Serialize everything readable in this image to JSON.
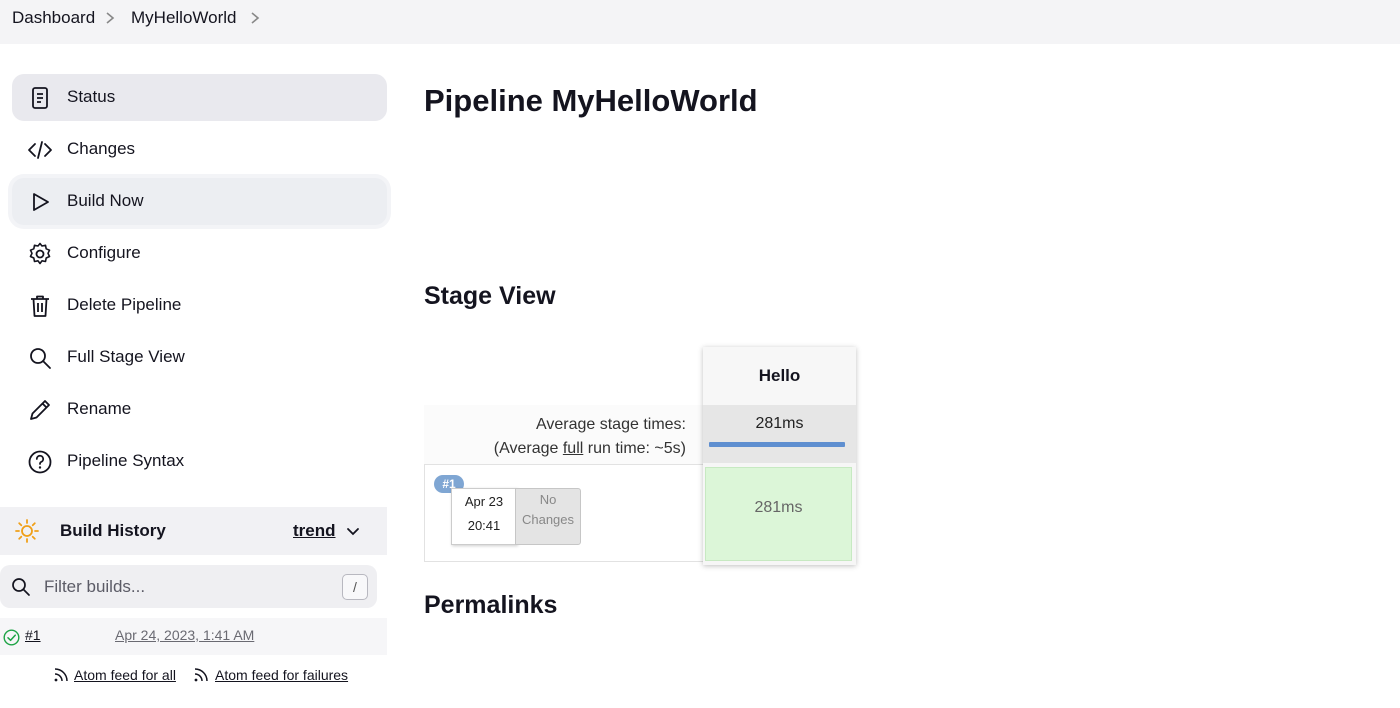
{
  "breadcrumb": {
    "items": [
      "Dashboard",
      "MyHelloWorld"
    ]
  },
  "sidebar": {
    "items": [
      {
        "label": "Status",
        "icon": "document-icon"
      },
      {
        "label": "Changes",
        "icon": "code-icon"
      },
      {
        "label": "Build Now",
        "icon": "play-icon"
      },
      {
        "label": "Configure",
        "icon": "gear-icon"
      },
      {
        "label": "Delete Pipeline",
        "icon": "trash-icon"
      },
      {
        "label": "Full Stage View",
        "icon": "search-icon"
      },
      {
        "label": "Rename",
        "icon": "pencil-icon"
      },
      {
        "label": "Pipeline Syntax",
        "icon": "help-icon"
      }
    ]
  },
  "build_history": {
    "title": "Build History",
    "trend": "trend",
    "filter_placeholder": "Filter builds...",
    "shortcut": "/",
    "builds": [
      {
        "number": "#1",
        "date": "Apr 24, 2023, 1:41 AM",
        "status": "success"
      }
    ],
    "feed_all": "Atom feed for all",
    "feed_failures": "Atom feed for failures"
  },
  "main": {
    "title": "Pipeline MyHelloWorld",
    "stage_view_title": "Stage View",
    "permalinks_title": "Permalinks",
    "avg_stage_times": "Average stage times:",
    "avg_run_prefix": "(Average ",
    "avg_run_link": "full",
    "avg_run_suffix": " run time: ~5s)",
    "stage_name": "Hello",
    "stage_avg": "281ms",
    "run": {
      "badge": "#1",
      "date": "Apr 23",
      "time": "20:41",
      "changes_line1": "No",
      "changes_line2": "Changes",
      "stage_duration": "281ms"
    }
  },
  "colors": {
    "accent_blue": "#5f8fd0",
    "success_green": "#dcf6d8",
    "sidebar_active": "#e9e9ee"
  }
}
